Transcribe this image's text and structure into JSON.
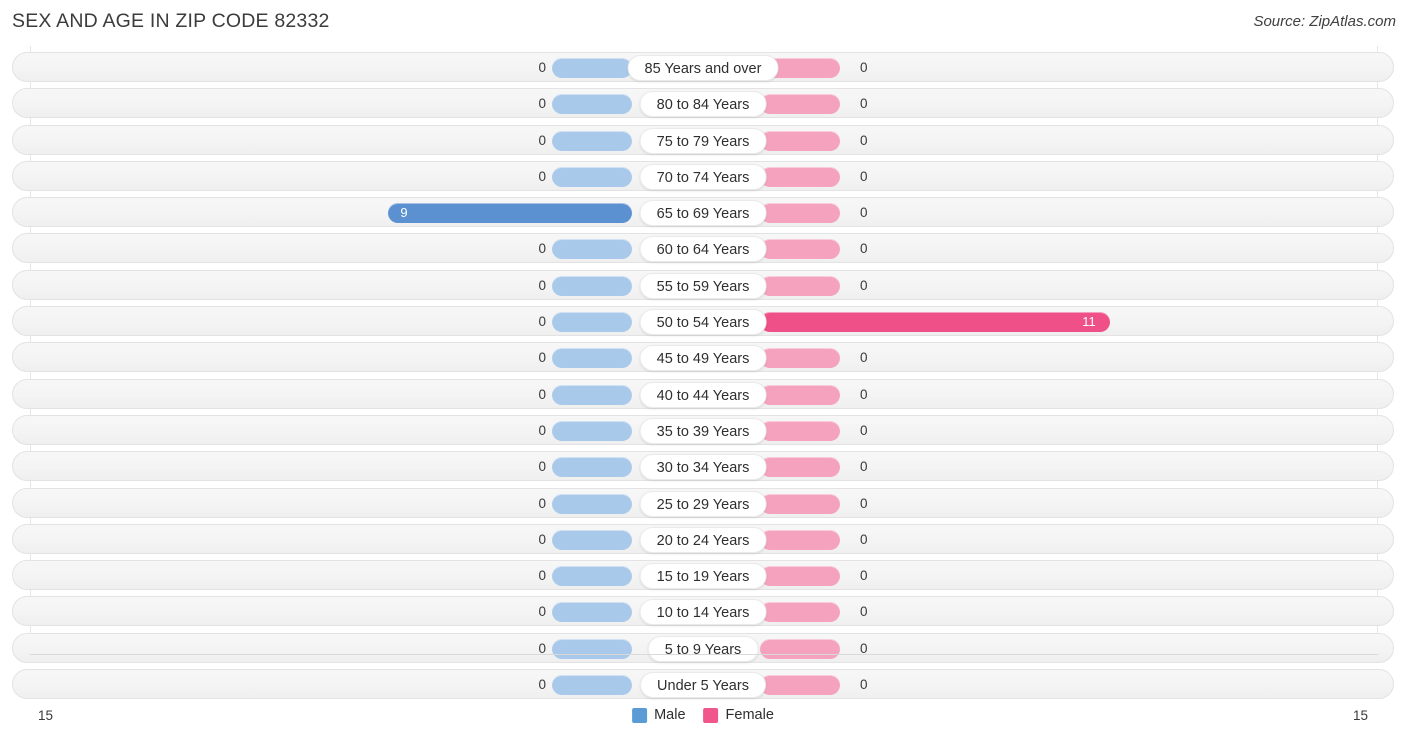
{
  "header": {
    "title": "SEX AND AGE IN ZIP CODE 82332",
    "source": "Source: ZipAtlas.com"
  },
  "legend": {
    "male_label": "Male",
    "female_label": "Female",
    "male_color": "#5b9bd5",
    "female_color": "#f0558c"
  },
  "axis": {
    "left_end": "15",
    "right_end": "15"
  },
  "chart_data": {
    "type": "bar",
    "orientation": "horizontal-diverging",
    "title": "SEX AND AGE IN ZIP CODE 82332",
    "xlabel": "",
    "ylabel": "",
    "axis_max": 15,
    "xlim": [
      15,
      15
    ],
    "grid": true,
    "legend_position": "bottom-center",
    "categories": [
      "85 Years and over",
      "80 to 84 Years",
      "75 to 79 Years",
      "70 to 74 Years",
      "65 to 69 Years",
      "60 to 64 Years",
      "55 to 59 Years",
      "50 to 54 Years",
      "45 to 49 Years",
      "40 to 44 Years",
      "35 to 39 Years",
      "30 to 34 Years",
      "25 to 29 Years",
      "20 to 24 Years",
      "15 to 19 Years",
      "10 to 14 Years",
      "5 to 9 Years",
      "Under 5 Years"
    ],
    "series": [
      {
        "name": "Male",
        "color": "#5b9bd5",
        "values": [
          0,
          0,
          0,
          0,
          9,
          0,
          0,
          0,
          0,
          0,
          0,
          0,
          0,
          0,
          0,
          0,
          0,
          0
        ]
      },
      {
        "name": "Female",
        "color": "#f0558c",
        "values": [
          0,
          0,
          0,
          0,
          0,
          0,
          0,
          11,
          0,
          0,
          0,
          0,
          0,
          0,
          0,
          0,
          0,
          0
        ]
      }
    ]
  },
  "rows": [
    {
      "label": "85 Years and over",
      "male": "0",
      "female": "0"
    },
    {
      "label": "80 to 84 Years",
      "male": "0",
      "female": "0"
    },
    {
      "label": "75 to 79 Years",
      "male": "0",
      "female": "0"
    },
    {
      "label": "70 to 74 Years",
      "male": "0",
      "female": "0"
    },
    {
      "label": "65 to 69 Years",
      "male": "9",
      "female": "0"
    },
    {
      "label": "60 to 64 Years",
      "male": "0",
      "female": "0"
    },
    {
      "label": "55 to 59 Years",
      "male": "0",
      "female": "0"
    },
    {
      "label": "50 to 54 Years",
      "male": "0",
      "female": "11"
    },
    {
      "label": "45 to 49 Years",
      "male": "0",
      "female": "0"
    },
    {
      "label": "40 to 44 Years",
      "male": "0",
      "female": "0"
    },
    {
      "label": "35 to 39 Years",
      "male": "0",
      "female": "0"
    },
    {
      "label": "30 to 34 Years",
      "male": "0",
      "female": "0"
    },
    {
      "label": "25 to 29 Years",
      "male": "0",
      "female": "0"
    },
    {
      "label": "20 to 24 Years",
      "male": "0",
      "female": "0"
    },
    {
      "label": "15 to 19 Years",
      "male": "0",
      "female": "0"
    },
    {
      "label": "10 to 14 Years",
      "male": "0",
      "female": "0"
    },
    {
      "label": "5 to 9 Years",
      "male": "0",
      "female": "0"
    },
    {
      "label": "Under 5 Years",
      "male": "0",
      "female": "0"
    }
  ]
}
